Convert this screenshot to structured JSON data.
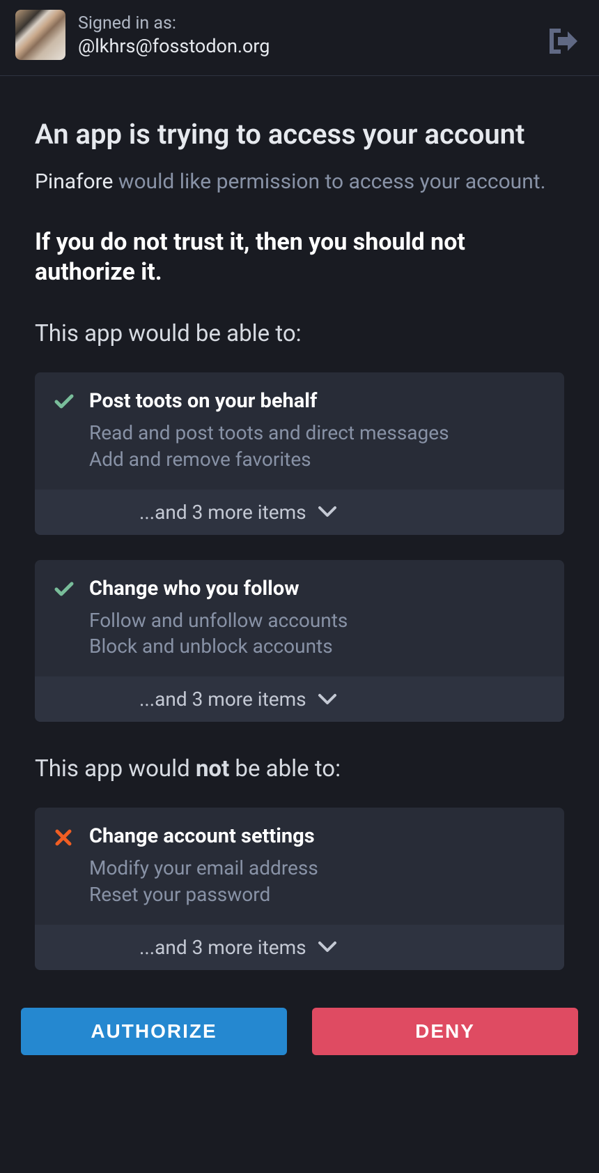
{
  "header": {
    "signed_in_label": "Signed in as:",
    "handle": "@lkhrs@fosstodon.org"
  },
  "page": {
    "title": "An app is trying to access your account",
    "app_name": "Pinafore",
    "permission_suffix": " would like permission to access your account.",
    "trust_warning": "If you do not trust it, then you should not authorize it.",
    "able_label": "This app would be able to:",
    "not_able_prefix": "This app would ",
    "not_able_bold": "not",
    "not_able_suffix": " be able to:"
  },
  "permissions_allowed": [
    {
      "title": "Post toots on your behalf",
      "desc_lines": [
        "Read and post toots and direct messages",
        "Add and remove favorites"
      ],
      "more": "...and 3 more items"
    },
    {
      "title": "Change who you follow",
      "desc_lines": [
        "Follow and unfollow accounts",
        "Block and unblock accounts"
      ],
      "more": "...and 3 more items"
    }
  ],
  "permissions_denied": [
    {
      "title": "Change account settings",
      "desc_lines": [
        "Modify your email address",
        "Reset your password"
      ],
      "more": "...and 3 more items"
    }
  ],
  "buttons": {
    "authorize": "AUTHORIZE",
    "deny": "DENY"
  },
  "colors": {
    "check": "#79bd9a",
    "cross": "#f05e23",
    "authorize": "#2588d0",
    "deny": "#df4b62"
  }
}
